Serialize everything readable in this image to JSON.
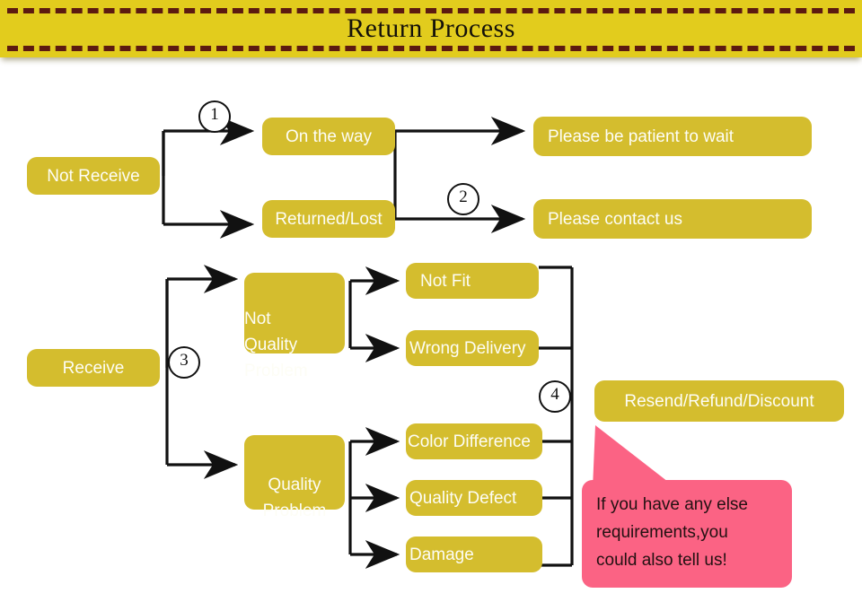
{
  "banner": {
    "title": "Return Process",
    "background_color": "#e2cc1d",
    "dash_color": "#5c1a10"
  },
  "theme": {
    "node_color": "#d4bd2e",
    "node_text_color": "#fdfdf5",
    "callout_color": "#fb6384",
    "edge_color": "#111111",
    "page_background": "#ffffff"
  },
  "flow": {
    "roots": [
      {
        "id": "not-receive",
        "label": "Not Receive"
      },
      {
        "id": "receive",
        "label": "Receive"
      }
    ],
    "branch_nodes": [
      {
        "id": "on-the-way",
        "label": "On the way"
      },
      {
        "id": "returned-lost",
        "label": "Returned/Lost"
      },
      {
        "id": "not-quality-problem",
        "label": "Not\nQuality\nProblem"
      },
      {
        "id": "quality-problem",
        "label": "Quality\nProblem"
      }
    ],
    "outcome_nodes": [
      {
        "id": "please-be-patient",
        "label": "Please be patient to wait"
      },
      {
        "id": "please-contact-us",
        "label": "Please contact us"
      }
    ],
    "leaf_nodes": [
      {
        "id": "not-fit",
        "label": "Not Fit"
      },
      {
        "id": "wrong-delivery",
        "label": "Wrong Delivery"
      },
      {
        "id": "color-difference",
        "label": "Color Difference"
      },
      {
        "id": "quality-defect",
        "label": "Quality Defect"
      },
      {
        "id": "damage",
        "label": "Damage"
      }
    ],
    "resolution_node": {
      "id": "resend-refund-discount",
      "label": "Resend/Refund/Discount"
    },
    "markers": [
      {
        "id": "marker-1",
        "label": "1"
      },
      {
        "id": "marker-2",
        "label": "2"
      },
      {
        "id": "marker-3",
        "label": "3"
      },
      {
        "id": "marker-4",
        "label": "4"
      }
    ]
  },
  "callout": {
    "text": "If you have any else\nrequirements,you\ncould also tell us!"
  }
}
